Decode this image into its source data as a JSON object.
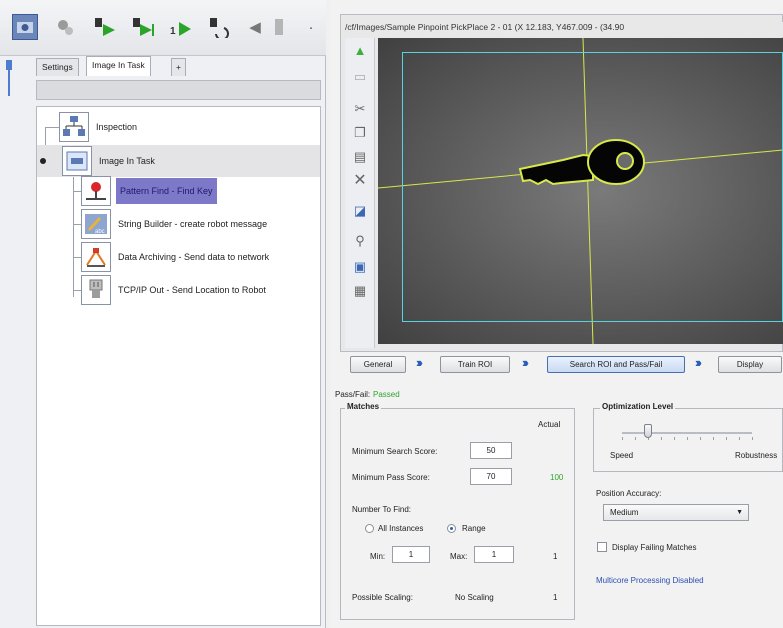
{
  "left": {
    "tabs": {
      "settings": "Settings",
      "image_in_task": "Image In Task",
      "add": "+"
    },
    "tree": [
      {
        "label": "Inspection",
        "icon": "inspection-icon"
      },
      {
        "label": "Image In Task",
        "icon": "image-icon"
      },
      {
        "label": "Pattern Find - Find Key",
        "icon": "pattern-find-icon"
      },
      {
        "label": "String Builder - create robot message",
        "icon": "string-builder-icon"
      },
      {
        "label": "Data Archiving - Send data to network",
        "icon": "data-archiving-icon"
      },
      {
        "label": "TCP/IP Out - Send Location to Robot",
        "icon": "tcpip-out-icon"
      }
    ]
  },
  "image_path": "/cf/Images/Sample Pinpoint PickPlace 2 - 01 (X 12.183, Y467.009 - (34.90",
  "steps": {
    "general": "General",
    "train_roi": "Train ROI",
    "search_roi": "Search ROI and Pass/Fail",
    "display": "Display"
  },
  "passfail": {
    "label": "Pass/Fail:",
    "value": "Passed"
  },
  "matches": {
    "title": "Matches",
    "actual_header": "Actual",
    "min_search_label": "Minimum Search Score:",
    "min_search_value": "50",
    "min_pass_label": "Minimum Pass Score:",
    "min_pass_value": "70",
    "min_pass_actual": "100",
    "number_to_find_label": "Number To Find:",
    "all_instances": "All Instances",
    "range": "Range",
    "min_label": "Min:",
    "min_value": "1",
    "max_label": "Max:",
    "max_value": "1",
    "range_actual": "1",
    "scaling_label": "Possible Scaling:",
    "scaling_value": "No Scaling",
    "scaling_actual": "1"
  },
  "optimization": {
    "title": "Optimization Level",
    "speed": "Speed",
    "robustness": "Robustness",
    "slider_fraction": 0.2
  },
  "position_accuracy": {
    "label": "Position Accuracy:",
    "value": "Medium"
  },
  "display_failing": "Display Failing Matches",
  "multicore": "Multicore Processing Disabled",
  "colors": {
    "accent": "#2a5fb8",
    "passed": "#2fa52f",
    "selection": "#7d79c8",
    "roi": "#56d3e0",
    "outline": "#d9e84a"
  }
}
